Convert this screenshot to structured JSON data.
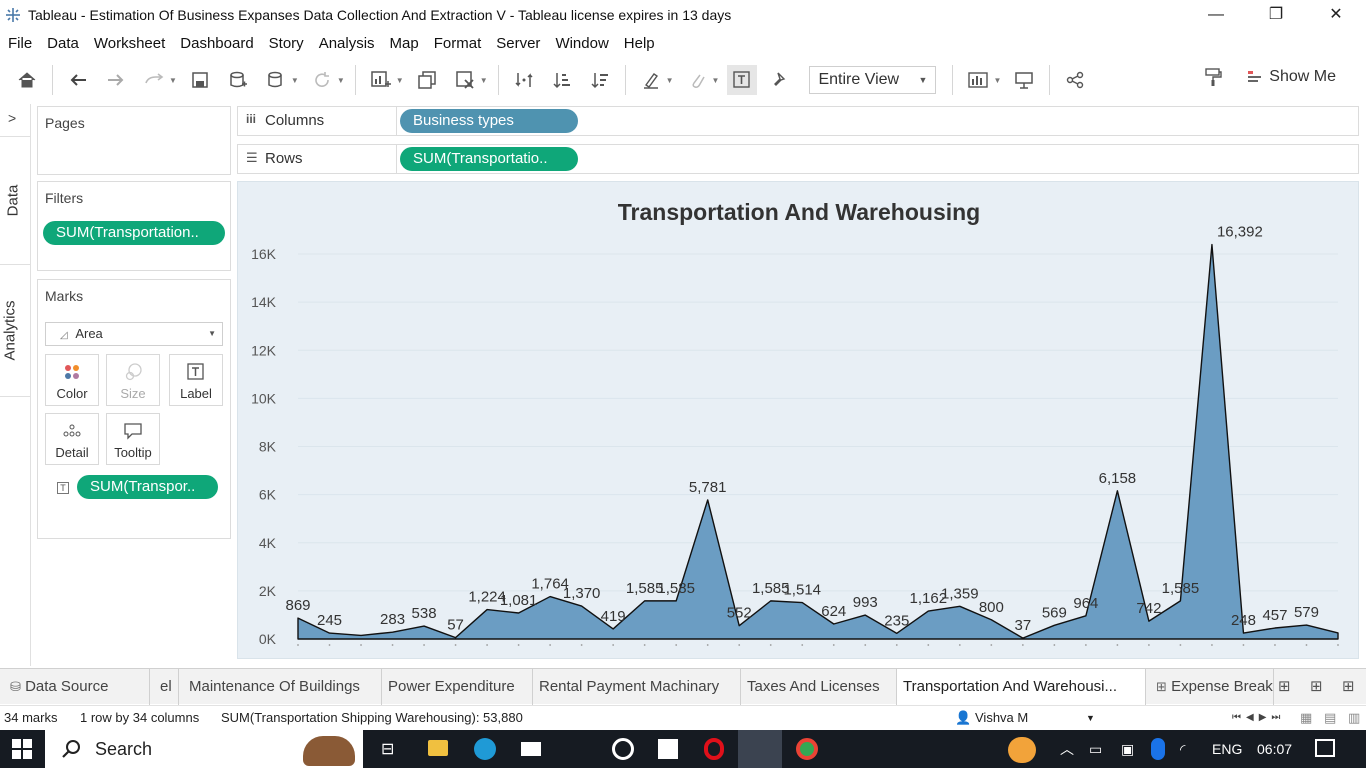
{
  "window": {
    "title": "Tableau - Estimation Of Business Expanses Data Collection And Extraction V - Tableau license expires in 13 days",
    "minimize": "—",
    "maximize": "❐",
    "close": "✕"
  },
  "menu": [
    "File",
    "Data",
    "Worksheet",
    "Dashboard",
    "Story",
    "Analysis",
    "Map",
    "Format",
    "Server",
    "Window",
    "Help"
  ],
  "toolbar": {
    "fit_value": "Entire View",
    "show_me": "Show Me"
  },
  "side_tabs": {
    "data": "Data",
    "analytics": "Analytics"
  },
  "pages_card": {
    "title": "Pages"
  },
  "filters_card": {
    "title": "Filters",
    "pill": "SUM(Transportation.."
  },
  "marks_card": {
    "title": "Marks",
    "mark_type": "Area",
    "buttons": {
      "color": "Color",
      "size": "Size",
      "label": "Label",
      "detail": "Detail",
      "tooltip": "Tooltip"
    },
    "pill": "SUM(Transpor.."
  },
  "shelves": {
    "columns_label": "Columns",
    "columns_pill": "Business types",
    "rows_label": "Rows",
    "rows_pill": "SUM(Transportatio.."
  },
  "colors": {
    "area_fill": "#6b9dc3",
    "pill_green": "#0fa779",
    "pill_blue": "#4f93b0",
    "chart_bg": "#e8eff5"
  },
  "chart_data": {
    "type": "area",
    "title": "Transportation And Warehousing",
    "xlabel": "",
    "ylabel": "",
    "ylim": [
      0,
      17000
    ],
    "y_ticks": [
      "0K",
      "2K",
      "4K",
      "6K",
      "8K",
      "10K",
      "12K",
      "14K",
      "16K"
    ],
    "values": [
      869,
      245,
      150,
      283,
      538,
      57,
      1224,
      1081,
      1764,
      1370,
      419,
      1585,
      1585,
      5781,
      552,
      1585,
      1514,
      624,
      993,
      235,
      1162,
      1359,
      800,
      37,
      569,
      964,
      6158,
      742,
      1585,
      16392,
      248,
      457,
      579,
      250
    ],
    "labels": [
      "869",
      "245",
      "",
      "283",
      "538",
      "57",
      "1,224",
      "1,081",
      "1,764",
      "1,370",
      "419",
      "1,585",
      "1,585",
      "5,781",
      "552",
      "1,585",
      "1,514",
      "624",
      "993",
      "235",
      "1,162",
      "1,359",
      "800",
      "37",
      "569",
      "964",
      "6,158",
      "742",
      "1,585",
      "16,392",
      "248",
      "457",
      "579",
      ""
    ],
    "grid": true,
    "legend": "none"
  },
  "tabs": {
    "data_source": "Data Source",
    "partial": "el",
    "items": [
      "Maintenance Of Buildings",
      "Power Expenditure",
      "Rental Payment Machinary",
      "Taxes And Licenses",
      "Transportation And Warehousi...",
      "Expense Break"
    ]
  },
  "status": {
    "marks": "34 marks",
    "rows_cols": "1 row by 34 columns",
    "sum": "SUM(Transportation Shipping Warehousing): 53,880",
    "user": "Vishva M"
  },
  "taskbar": {
    "search": "Search",
    "lang": "ENG",
    "time": "06:07"
  }
}
